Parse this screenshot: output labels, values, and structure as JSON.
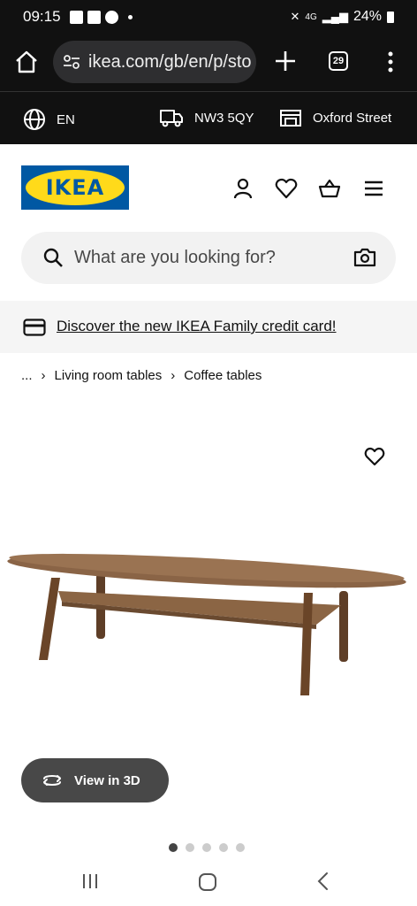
{
  "status_bar": {
    "time": "09:15",
    "battery": "24%",
    "network": "4G"
  },
  "browser": {
    "url": "ikea.com/gb/en/p/sto",
    "tab_count": "29"
  },
  "top_strip": {
    "language": "EN",
    "postcode": "NW3 5QY",
    "store": "Oxford Street"
  },
  "header": {
    "logo_text": "IKEA",
    "brand_blue": "#0058a3",
    "brand_yellow": "#ffda1a"
  },
  "search": {
    "placeholder": "What are you looking for?"
  },
  "promo": {
    "text": "Discover the new IKEA Family credit card!"
  },
  "breadcrumb": {
    "ellipsis": "...",
    "items": [
      "Living room tables",
      "Coffee tables"
    ]
  },
  "product": {
    "view3d_label": "View in 3D",
    "image_count": 5,
    "active_image": 1
  }
}
